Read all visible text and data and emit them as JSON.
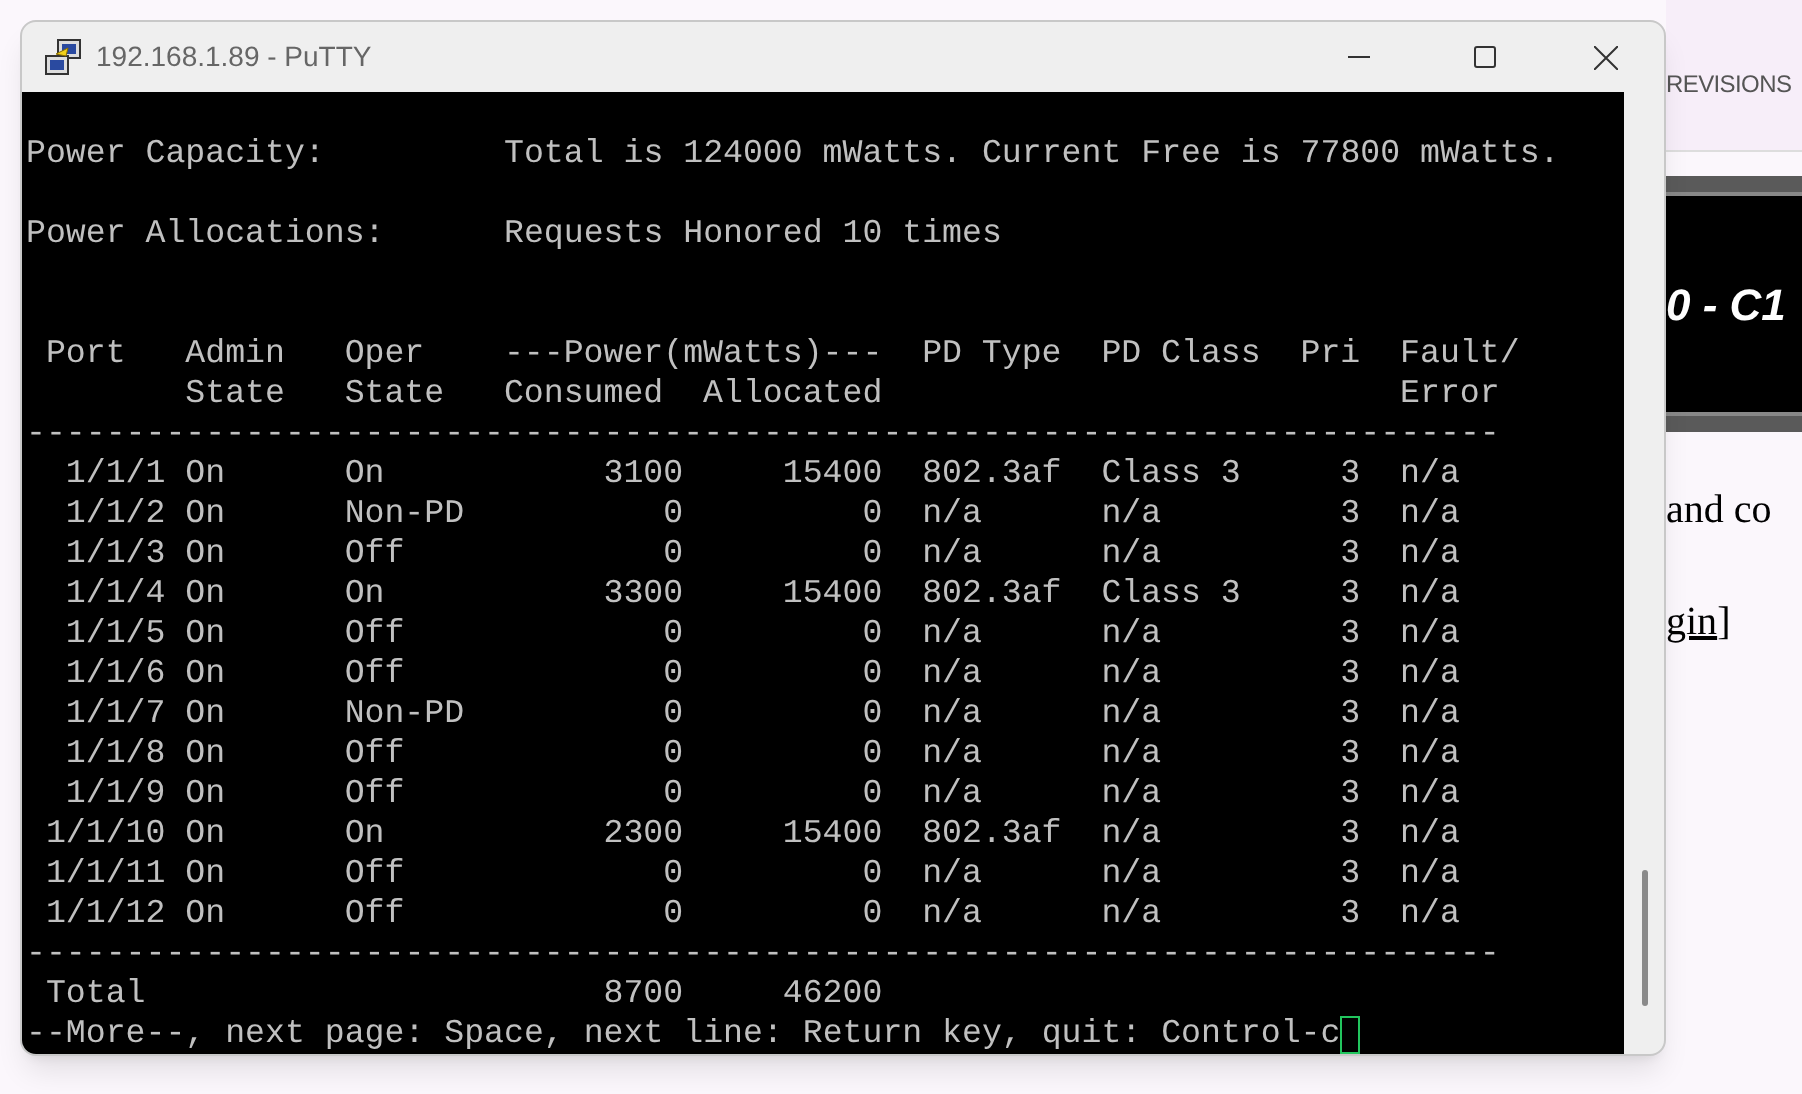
{
  "window": {
    "title": "192.168.1.89 - PuTTY"
  },
  "terminal": {
    "power_capacity": {
      "label": "Power Capacity:",
      "value": "Total is 124000 mWatts. Current Free is 77800 mWatts."
    },
    "power_allocations": {
      "label": "Power Allocations:",
      "value": "Requests Honored 10 times"
    },
    "table": {
      "header": {
        "port": "Port",
        "admin": [
          "Admin",
          "State"
        ],
        "oper": [
          "Oper",
          "State"
        ],
        "power": "---Power(mWatts)---",
        "consumed": "Consumed",
        "allocated": "Allocated",
        "pd_type": "PD Type",
        "pd_class": "PD Class",
        "pri": "Pri",
        "fault": [
          "Fault/",
          "Error"
        ]
      },
      "rule_top": "--------------------------------------------------------------------------",
      "rows": [
        {
          "port": "1/1/1",
          "admin_state": "On",
          "oper_state": "On",
          "consumed": "3100",
          "allocated": "15400",
          "pd_type": "802.3af",
          "pd_class": "Class 3",
          "pri": "3",
          "fault_error": "n/a"
        },
        {
          "port": "1/1/2",
          "admin_state": "On",
          "oper_state": "Non-PD",
          "consumed": "0",
          "allocated": "0",
          "pd_type": "n/a",
          "pd_class": "n/a",
          "pri": "3",
          "fault_error": "n/a"
        },
        {
          "port": "1/1/3",
          "admin_state": "On",
          "oper_state": "Off",
          "consumed": "0",
          "allocated": "0",
          "pd_type": "n/a",
          "pd_class": "n/a",
          "pri": "3",
          "fault_error": "n/a"
        },
        {
          "port": "1/1/4",
          "admin_state": "On",
          "oper_state": "On",
          "consumed": "3300",
          "allocated": "15400",
          "pd_type": "802.3af",
          "pd_class": "Class 3",
          "pri": "3",
          "fault_error": "n/a"
        },
        {
          "port": "1/1/5",
          "admin_state": "On",
          "oper_state": "Off",
          "consumed": "0",
          "allocated": "0",
          "pd_type": "n/a",
          "pd_class": "n/a",
          "pri": "3",
          "fault_error": "n/a"
        },
        {
          "port": "1/1/6",
          "admin_state": "On",
          "oper_state": "Off",
          "consumed": "0",
          "allocated": "0",
          "pd_type": "n/a",
          "pd_class": "n/a",
          "pri": "3",
          "fault_error": "n/a"
        },
        {
          "port": "1/1/7",
          "admin_state": "On",
          "oper_state": "Non-PD",
          "consumed": "0",
          "allocated": "0",
          "pd_type": "n/a",
          "pd_class": "n/a",
          "pri": "3",
          "fault_error": "n/a"
        },
        {
          "port": "1/1/8",
          "admin_state": "On",
          "oper_state": "Off",
          "consumed": "0",
          "allocated": "0",
          "pd_type": "n/a",
          "pd_class": "n/a",
          "pri": "3",
          "fault_error": "n/a"
        },
        {
          "port": "1/1/9",
          "admin_state": "On",
          "oper_state": "Off",
          "consumed": "0",
          "allocated": "0",
          "pd_type": "n/a",
          "pd_class": "n/a",
          "pri": "3",
          "fault_error": "n/a"
        },
        {
          "port": "1/1/10",
          "admin_state": "On",
          "oper_state": "On",
          "consumed": "2300",
          "allocated": "15400",
          "pd_type": "802.3af",
          "pd_class": "n/a",
          "pri": "3",
          "fault_error": "n/a"
        },
        {
          "port": "1/1/11",
          "admin_state": "On",
          "oper_state": "Off",
          "consumed": "0",
          "allocated": "0",
          "pd_type": "n/a",
          "pd_class": "n/a",
          "pri": "3",
          "fault_error": "n/a"
        },
        {
          "port": "1/1/12",
          "admin_state": "On",
          "oper_state": "Off",
          "consumed": "0",
          "allocated": "0",
          "pd_type": "n/a",
          "pd_class": "n/a",
          "pri": "3",
          "fault_error": "n/a"
        }
      ],
      "rule_bottom": "--------------------------------------------------------------------------",
      "total": {
        "label": "Total",
        "consumed": "8700",
        "allocated": "46200"
      }
    },
    "prompt": "--More--, next page: Space, next line: Return key, quit: Control-c"
  },
  "background_page": {
    "nav_item": "REVISIONS",
    "banner_title": "0 - C1",
    "text_line": "and co",
    "link": "gin",
    "bracket": "]"
  }
}
